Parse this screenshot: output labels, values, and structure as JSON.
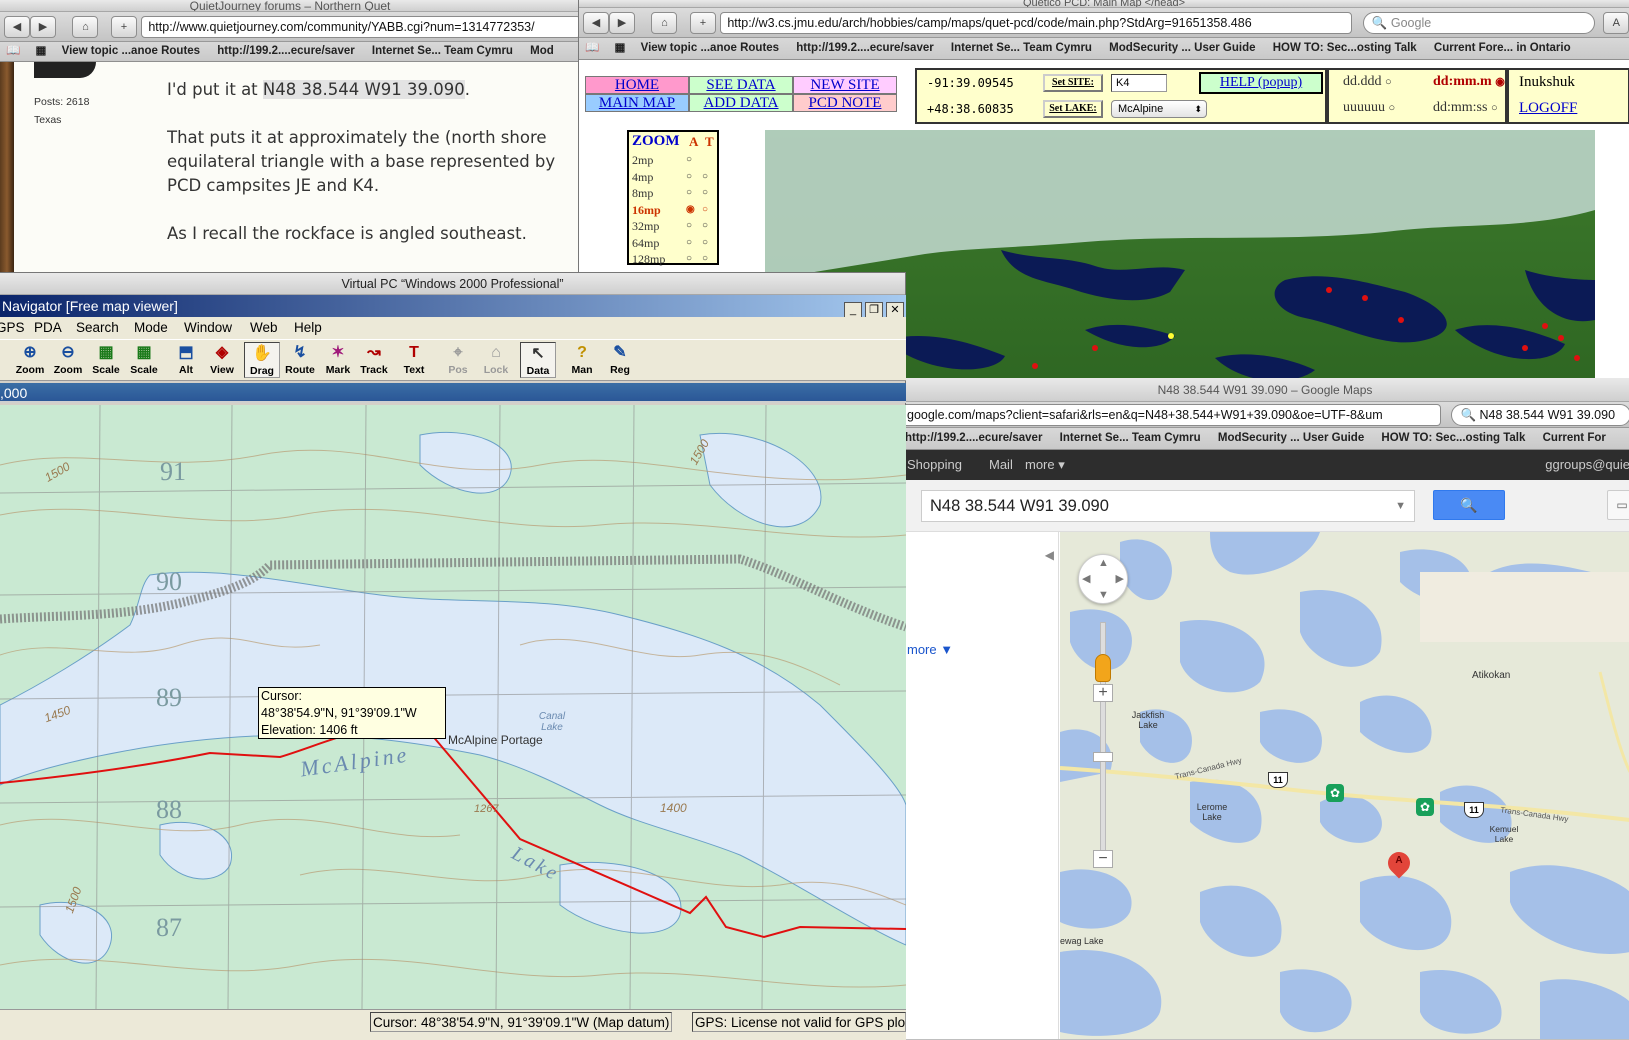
{
  "forum_window": {
    "title": "QuietJourney forums – Northern Quet",
    "url": "http://www.quietjourney.com/community/YABB.cgi?num=1314772353/",
    "bookmarks": [
      "View topic ...anoe Routes",
      "http://199.2....ecure/saver",
      "Internet Se... Team Cymru",
      "Mod"
    ],
    "poster_posts": "Posts: 2618",
    "poster_location": "Texas",
    "para1_prefix": "I'd put it at ",
    "para1_coord": "N48 38.544 W91 39.090",
    "para1_suffix": ".",
    "para2_line1": "That puts it at approximately the (north shore",
    "para2_line2": "equilateral triangle with a base represented by",
    "para2_line3": "PCD campsites JE and K4.",
    "para3": "As I recall the rockface is angled southeast."
  },
  "quetico_window": {
    "title": "Quetico PCD: Main Map </head>",
    "url": "http://w3.cs.jmu.edu/arch/hobbies/camp/maps/quet-pcd/code/main.php?StdArg=91651358.486",
    "search_placeholder": "Google",
    "reader_label": "A",
    "bookmarks": [
      "View topic ...anoe Routes",
      "http://199.2....ecure/saver",
      "Internet Se... Team Cymru",
      "ModSecurity ... User Guide",
      "HOW TO: Sec...osting Talk",
      "Current Fore... in Ontario"
    ],
    "nav": {
      "home": "HOME",
      "see_data": "SEE DATA",
      "new_site": "NEW SITE",
      "main_map": "MAIN MAP",
      "add_data": "ADD DATA",
      "pcd_note": "PCD NOTE"
    },
    "longitude": "-91:39.09545",
    "latitude": "+48:38.60835",
    "set_site_label": "Set SITE:",
    "site_value": "K4",
    "set_lake_label": "Set LAKE:",
    "lake_value": "McAlpine",
    "help_label": "HELP (popup)",
    "fmt_dd": "dd.ddd",
    "fmt_ddmm": "dd:mm.m",
    "fmt_uuuu": "uuuuuu",
    "fmt_ddmmss": "dd:mm:ss",
    "inukshuk": "Inukshuk",
    "logoff": "LOGOFF",
    "zoom_header": "ZOOM",
    "zoom_col_a": "A",
    "zoom_col_t": "T",
    "zoom_levels": [
      "2mp",
      "4mp",
      "8mp",
      "16mp",
      "32mp",
      "64mp",
      "128mp"
    ],
    "zoom_selected": "16mp"
  },
  "navigator_window": {
    "vpc_title": "Virtual PC “Windows 2000 Professional”",
    "title": "Navigator [Free map viewer]",
    "menu": [
      "GPS",
      "PDA",
      "Search",
      "Mode",
      "Window",
      "Web",
      "Help"
    ],
    "toolbar": [
      "Zoom",
      "Zoom",
      "Scale",
      "Scale",
      "Alt",
      "View",
      "Drag",
      "Route",
      "Mark",
      "Track",
      "Text",
      "Pos",
      "Lock",
      "Data",
      "Man",
      "Reg"
    ],
    "scale_bar": ",000",
    "tooltip_line1": "Cursor:",
    "tooltip_line2": "48°38'54.9\"N, 91°39'09.1\"W",
    "tooltip_line3": "Elevation: 1406 ft",
    "map_labels": {
      "grid_91": "91",
      "grid_90": "90",
      "grid_89": "89",
      "grid_88": "88",
      "grid_87": "87",
      "c1500a": "1500",
      "c1500b": "1500",
      "c1450": "1450",
      "c1400": "1400",
      "c1267": "1267",
      "c1500c": "1500",
      "mcalpine": "McAlpine",
      "lake": "Lake",
      "portage": "McAlpine Portage",
      "canal_lake": "Canal Lake"
    },
    "status_cursor": "Cursor: 48°38'54.9\"N, 91°39'09.1\"W (Map datum)",
    "status_gps": "GPS: License not valid for GPS plot"
  },
  "gmaps_window": {
    "title": "N48 38.544 W91 39.090 – Google Maps",
    "url": "google.com/maps?client=safari&rls=en&q=N48+38.544+W91+39.090&oe=UTF-8&um",
    "search_bar_text": "N48 38.544 W91 39.090",
    "bookmarks": [
      "http://199.2....ecure/saver",
      "Internet Se... Team Cymru",
      "ModSecurity ... User Guide",
      "HOW TO: Sec...osting Talk",
      "Current For"
    ],
    "nav_links": [
      "Shopping",
      "Mail",
      "more ▾"
    ],
    "account": "ggroups@quie",
    "query": "N48 38.544 W91 39.090",
    "more_link": "more ▼",
    "places": {
      "atikokan": "Atikokan",
      "jackfish": "Jackfish Lake",
      "lerome": "Lerome Lake",
      "kemuel": "Kemuel Lake",
      "ewag": "ewag Lake",
      "hwy_tc1": "Trans-Canada Hwy",
      "hwy_tc2": "Trans-Canada Hwy",
      "hwy11a": "11",
      "hwy11b": "11",
      "marker": "A"
    }
  }
}
